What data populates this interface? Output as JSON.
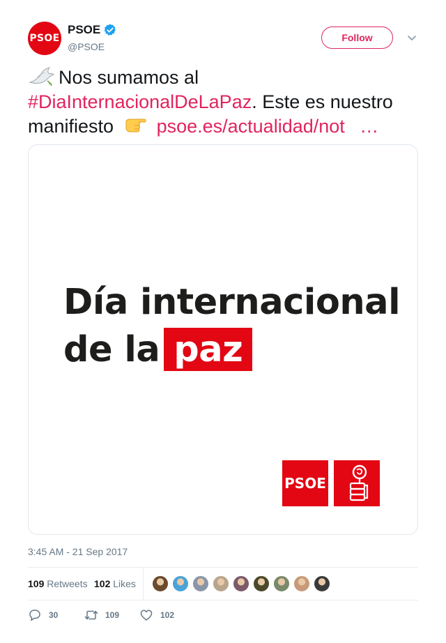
{
  "author": {
    "avatar_text": "PSOE",
    "name": "PSOE",
    "handle": "@PSOE",
    "follow_label": "Follow"
  },
  "tweet": {
    "text_part1": "Nos sumamos al",
    "hashtag": "#DiaInternacionalDeLaPaz",
    "text_part2": ". Este es nuestro manifiesto",
    "link": "psoe.es/actualidad/not",
    "ellipsis": "…"
  },
  "media": {
    "line1": "Día internacional",
    "line2_prefix": "de la",
    "line2_highlight": "paz",
    "logo_text": "PSOE"
  },
  "meta": {
    "timestamp": "3:45 AM - 21 Sep 2017"
  },
  "stats": {
    "retweets_count": "109",
    "retweets_label": "Retweets",
    "likes_count": "102",
    "likes_label": "Likes"
  },
  "actions": {
    "replies": "30",
    "retweets": "109",
    "likes": "102"
  },
  "colors": {
    "brand_red": "#e30613",
    "accent_pink": "#e0245e",
    "verified_blue": "#1da1f2",
    "muted": "#657786"
  },
  "liker_avatar_colors": [
    "#6b4a2e",
    "#4aa3d8",
    "#8a96a8",
    "#b9a58c",
    "#7d5a6a",
    "#4a4a2a",
    "#7a8a6a",
    "#c89a7a",
    "#3a3a3a"
  ]
}
